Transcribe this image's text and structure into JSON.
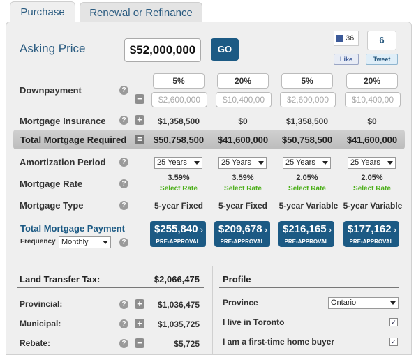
{
  "tabs": {
    "purchase": "Purchase",
    "renewal": "Renewal or Refinance"
  },
  "asking": {
    "label": "Asking Price",
    "value": "$52,000,000",
    "go": "GO"
  },
  "social": {
    "like_count": "36",
    "like_label": "Like",
    "tweet_count": "6",
    "tweet_label": "Tweet"
  },
  "downpayment": {
    "label": "Downpayment",
    "percents": [
      "5%",
      "20%",
      "5%",
      "20%"
    ],
    "amounts": [
      "$2,600,000",
      "$10,400,00",
      "$2,600,000",
      "$10,400,00"
    ]
  },
  "insurance": {
    "label": "Mortgage Insurance",
    "values": [
      "$1,358,500",
      "$0",
      "$1,358,500",
      "$0"
    ]
  },
  "total": {
    "label": "Total Mortgage Required",
    "values": [
      "$50,758,500",
      "$41,600,000",
      "$50,758,500",
      "$41,600,000"
    ]
  },
  "amortization": {
    "label": "Amortization Period",
    "values": [
      "25 Years",
      "25 Years",
      "25 Years",
      "25 Years"
    ]
  },
  "rate": {
    "label": "Mortgage Rate",
    "values": [
      "3.59%",
      "3.59%",
      "2.05%",
      "2.05%"
    ],
    "select": "Select Rate"
  },
  "type": {
    "label": "Mortgage Type",
    "values": [
      "5-year Fixed",
      "5-year Fixed",
      "5-year Variable",
      "5-year Variable"
    ]
  },
  "payment": {
    "label": "Total Mortgage Payment",
    "frequency_label": "Frequency",
    "frequency_value": "Monthly",
    "values": [
      "$255,840",
      "$209,678",
      "$216,165",
      "$177,162"
    ],
    "button_sub": "PRE-APPROVAL"
  },
  "ltt": {
    "label": "Land Transfer Tax:",
    "total": "$2,066,475",
    "provincial_label": "Provincial:",
    "provincial": "$1,036,475",
    "municipal_label": "Municipal:",
    "municipal": "$1,035,725",
    "rebate_label": "Rebate:",
    "rebate": "$5,725"
  },
  "profile": {
    "title": "Profile",
    "province_label": "Province",
    "province": "Ontario",
    "toronto_label": "I live in Toronto",
    "firsttime_label": "I am a first-time home buyer"
  }
}
